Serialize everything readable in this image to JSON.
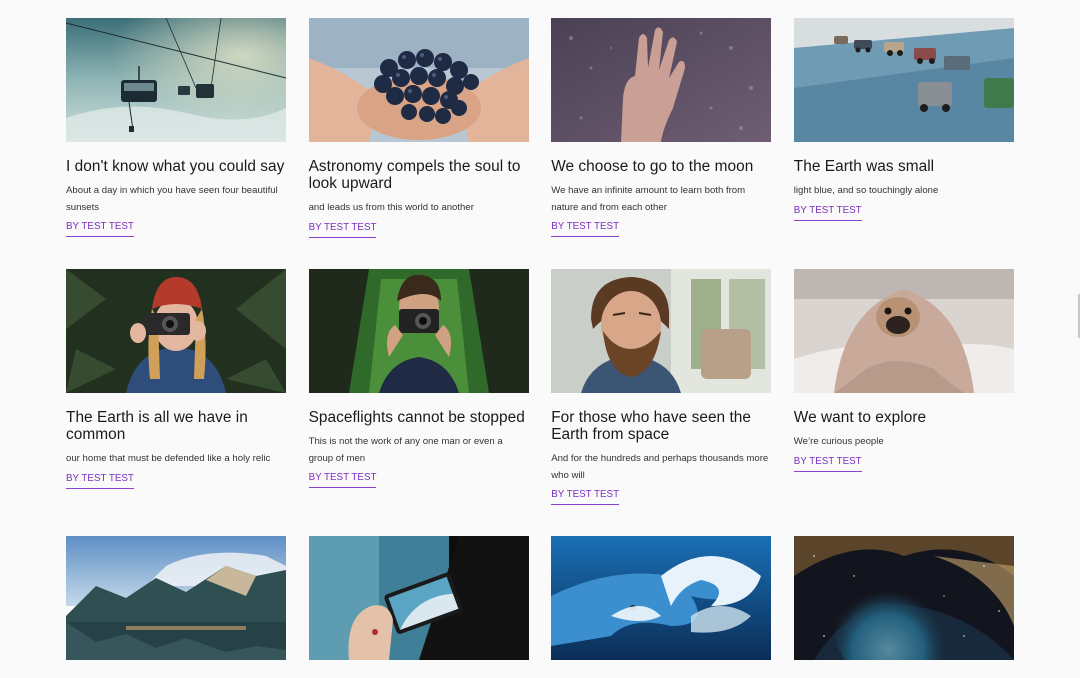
{
  "posts": [
    {
      "title": "I don't know what you could say",
      "excerpt": "About a day in which you have seen four beautiful sunsets",
      "byline": "BY TEST TEST",
      "image": "cable-car-mountain-mist"
    },
    {
      "title": "Astronomy compels the soul to look upward",
      "excerpt": "and leads us from this world to another",
      "byline": "BY TEST TEST",
      "image": "hands-holding-grapes"
    },
    {
      "title": "We choose to go to the moon",
      "excerpt": "We have an infinite amount to learn both from nature and from each other",
      "byline": "BY TEST TEST",
      "image": "hand-on-rainy-window"
    },
    {
      "title": "The Earth was small",
      "excerpt": "light blue, and so touchingly alone",
      "byline": "BY TEST TEST",
      "image": "toy-cars-on-shelf"
    },
    {
      "title": "The Earth is all we have in common",
      "excerpt": "our home that must be defended like a holy relic",
      "byline": "BY TEST TEST",
      "image": "woman-red-hat-camera"
    },
    {
      "title": "Spaceflights cannot be stopped",
      "excerpt": "This is not the work of any one man or even a group of men",
      "byline": "BY TEST TEST",
      "image": "man-camera-in-boat"
    },
    {
      "title": "For those who have seen the Earth from space",
      "excerpt": "And for the hundreds and perhaps thousands more who will",
      "byline": "BY TEST TEST",
      "image": "bearded-man-window"
    },
    {
      "title": "We want to explore",
      "excerpt": "We’re curious people",
      "byline": "BY TEST TEST",
      "image": "pug-in-blanket"
    },
    {
      "image": "mountain-lake"
    },
    {
      "image": "hand-phone-photo"
    },
    {
      "image": "surfer-wave"
    },
    {
      "image": "nebula-space"
    }
  ]
}
